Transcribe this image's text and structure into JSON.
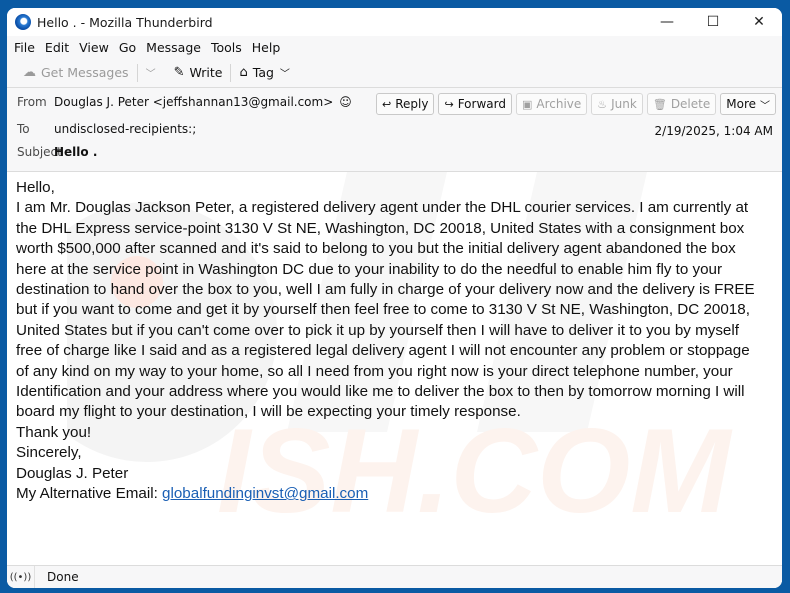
{
  "window": {
    "title": "Hello . - Mozilla Thunderbird",
    "controls": {
      "minimize": "—",
      "maximize": "☐",
      "close": "✕"
    }
  },
  "menubar": {
    "items": [
      {
        "label": "File",
        "accel": "F"
      },
      {
        "label": "Edit",
        "accel": "E"
      },
      {
        "label": "View",
        "accel": "V"
      },
      {
        "label": "Go",
        "accel": "G"
      },
      {
        "label": "Message",
        "accel": "M"
      },
      {
        "label": "Tools",
        "accel": "T"
      },
      {
        "label": "Help",
        "accel": "H"
      }
    ]
  },
  "toolbar": {
    "get_messages": "Get Messages",
    "write": "Write",
    "tag": "Tag"
  },
  "header": {
    "from_label": "From",
    "from_value": "Douglas J. Peter <jeffshannan13@gmail.com>",
    "to_label": "To",
    "to_value": "undisclosed-recipients:;",
    "subject_label": "Subject",
    "subject_value": "Hello .",
    "date": "2/19/2025, 1:04 AM",
    "actions": {
      "reply": "Reply",
      "forward": "Forward",
      "archive": "Archive",
      "junk": "Junk",
      "delete": "Delete",
      "more": "More"
    }
  },
  "message": {
    "lines": [
      "Hello,",
      "I am Mr. Douglas Jackson Peter, a registered delivery agent under the DHL courier services. I am currently at",
      "the DHL Express service-point 3130 V St NE, Washington, DC 20018, United States with a consignment box",
      "worth $500,000 after scanned and it's said to belong to you but the initial delivery agent abandoned the box",
      "here at the service point in Washington DC due to your inability to do the needful to enable him fly to your",
      "destination to hand over the box to you, well I am fully in charge of your delivery now and the delivery is FREE",
      "but if you want to come and get it by yourself then feel free to come to 3130 V St NE, Washington, DC 20018,",
      "United States but if you can't come over to pick it up by yourself then I will have to deliver it to you by myself",
      "free of charge like I said and as a registered legal delivery agent I will not encounter any problem or stoppage",
      "of any kind on my way to your home, so all I need from you right now is your direct telephone number, your",
      "Identification and your address where you would like me to deliver the box to then by tomorrow morning I will",
      "board my flight to your destination, I will be expecting your timely response.",
      "Thank you!",
      "Sincerely,",
      "Douglas J. Peter"
    ],
    "alt_email_label": "My Alternative Email: ",
    "alt_email": "globalfundinginvst@gmail.com"
  },
  "statusbar": {
    "text": "Done"
  },
  "colors": {
    "frame": "#0a5aa3",
    "link": "#1a5fb4"
  }
}
